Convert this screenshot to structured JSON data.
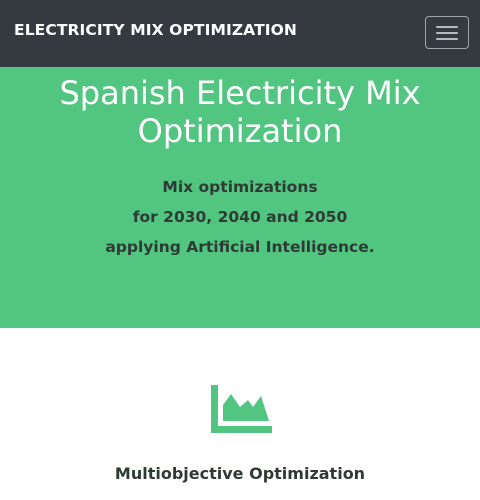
{
  "navbar": {
    "brand": "ELECTRICITY MIX OPTIMIZATION",
    "menu_icon": "hamburger-menu-icon"
  },
  "hero": {
    "title_line1": "Spanish Electricity Mix",
    "title_line2": "Optimization",
    "subtitle_line1": "Mix optimizations",
    "subtitle_line2": "for 2030, 2040 and 2050",
    "subtitle_line3": "applying Artificial Intelligence."
  },
  "feature": {
    "icon": "area-chart-icon",
    "title": "Multiobjective Optimization"
  },
  "colors": {
    "navbar_bg": "#343a40",
    "accent_green": "#52c681",
    "text_dark": "#2f3a34"
  }
}
